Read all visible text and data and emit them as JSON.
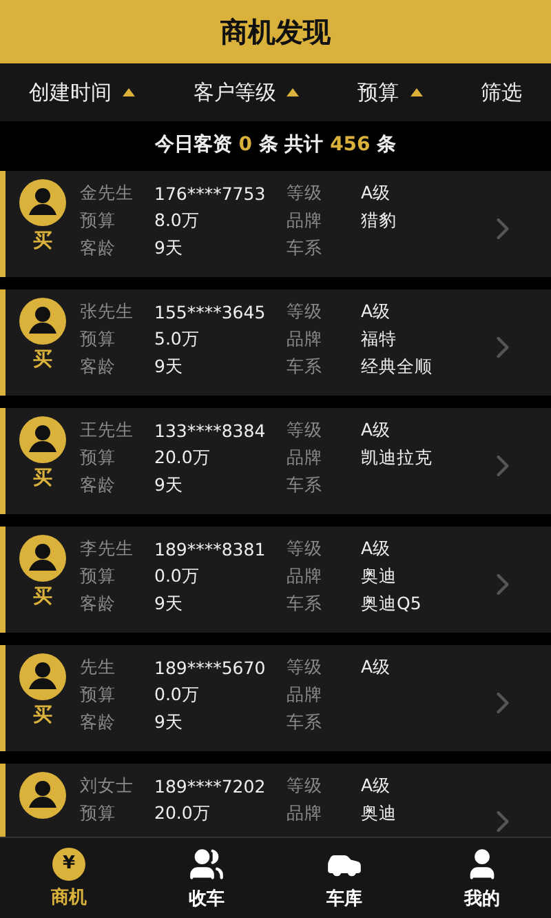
{
  "title": "商机发现",
  "filters": [
    {
      "label": "创建时间",
      "kind": "sort"
    },
    {
      "label": "客户等级",
      "kind": "sort"
    },
    {
      "label": "预算",
      "kind": "sort"
    },
    {
      "label": "筛选",
      "kind": "plain"
    }
  ],
  "summary": [
    {
      "text": "今日客资 ",
      "highlight": false
    },
    {
      "text": "0",
      "highlight": true
    },
    {
      "text": " 条 共计 ",
      "highlight": false
    },
    {
      "text": "456",
      "highlight": true
    },
    {
      "text": " 条",
      "highlight": false
    }
  ],
  "leads": [
    {
      "tag": "买",
      "name": "金先生",
      "phone": "176****7753",
      "left": [
        {
          "label": "预算",
          "value": "8.0万"
        },
        {
          "label": "客龄",
          "value": "9天"
        }
      ],
      "right": [
        {
          "label": "等级",
          "value": "A级"
        },
        {
          "label": "品牌",
          "value": "猎豹"
        },
        {
          "label": "车系"
        }
      ]
    },
    {
      "tag": "买",
      "name": "张先生",
      "phone": "155****3645",
      "left": [
        {
          "label": "预算",
          "value": "5.0万"
        },
        {
          "label": "客龄",
          "value": "9天"
        }
      ],
      "right": [
        {
          "label": "等级",
          "value": "A级"
        },
        {
          "label": "品牌",
          "value": "福特"
        },
        {
          "label": "车系",
          "value": "经典全顺"
        }
      ]
    },
    {
      "tag": "买",
      "name": "王先生",
      "phone": "133****8384",
      "left": [
        {
          "label": "预算",
          "value": "20.0万"
        },
        {
          "label": "客龄",
          "value": "9天"
        }
      ],
      "right": [
        {
          "label": "等级",
          "value": "A级"
        },
        {
          "label": "品牌",
          "value": "凯迪拉克"
        },
        {
          "label": "车系"
        }
      ]
    },
    {
      "tag": "买",
      "name": "李先生",
      "phone": "189****8381",
      "left": [
        {
          "label": "预算",
          "value": "0.0万"
        },
        {
          "label": "客龄",
          "value": "9天"
        }
      ],
      "right": [
        {
          "label": "等级",
          "value": "A级"
        },
        {
          "label": "品牌",
          "value": "奥迪"
        },
        {
          "label": "车系",
          "value": "奥迪Q5"
        }
      ]
    },
    {
      "tag": "买",
      "name": "先生",
      "phone": "189****5670",
      "left": [
        {
          "label": "预算",
          "value": "0.0万"
        },
        {
          "label": "客龄",
          "value": "9天"
        }
      ],
      "right": [
        {
          "label": "等级",
          "value": "A级"
        },
        {
          "label": "品牌"
        },
        {
          "label": "车系"
        }
      ]
    },
    {
      "name": "刘女士",
      "phone": "189****7202",
      "left": [
        {
          "label": "预算",
          "value": "20.0万"
        }
      ],
      "right": [
        {
          "label": "等级",
          "value": "A级"
        },
        {
          "label": "品牌",
          "value": "奥迪"
        }
      ]
    }
  ],
  "tabs": [
    {
      "label": "商机",
      "badge": "¥",
      "selected": true
    },
    {
      "label": "收车",
      "selected": false
    },
    {
      "label": "车库",
      "selected": false
    },
    {
      "label": "我的",
      "selected": false
    }
  ]
}
